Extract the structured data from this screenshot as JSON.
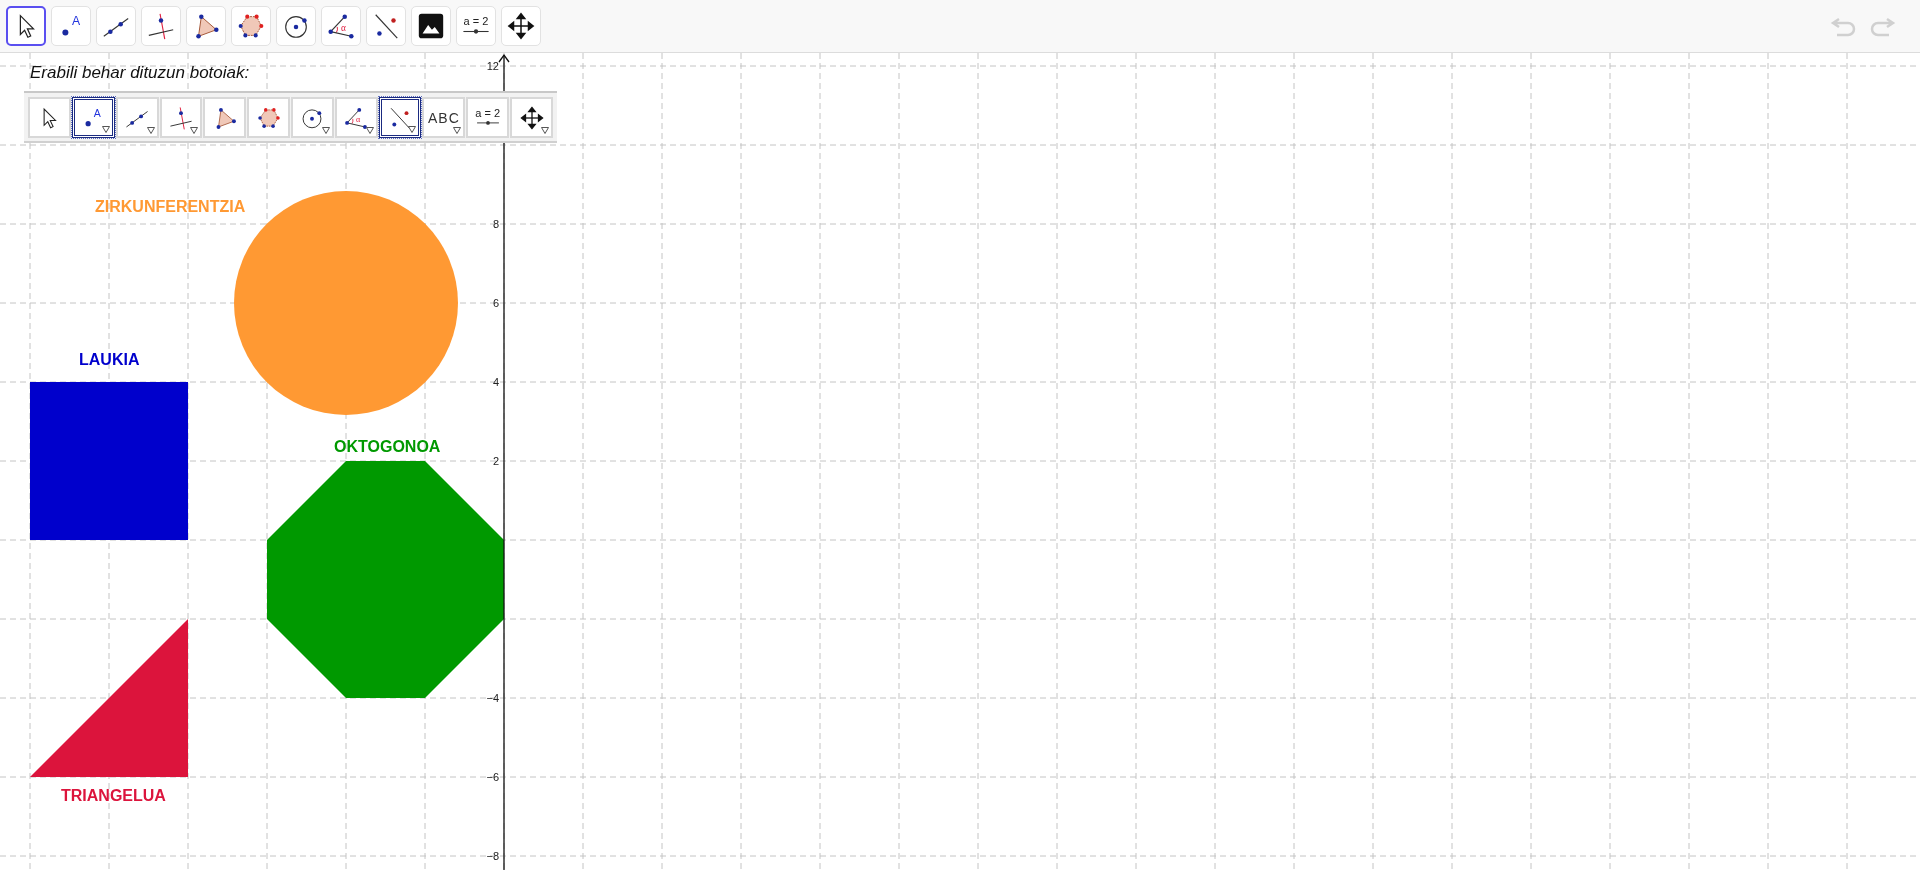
{
  "toolbar": {
    "tools": [
      {
        "kind": "move",
        "selected": true
      },
      {
        "kind": "point",
        "label": "A",
        "selected": false
      },
      {
        "kind": "line",
        "selected": false
      },
      {
        "kind": "perpendicular",
        "selected": false
      },
      {
        "kind": "polygon",
        "selected": false
      },
      {
        "kind": "regular_polygon",
        "selected": false
      },
      {
        "kind": "circle",
        "selected": false
      },
      {
        "kind": "angle",
        "label": "α",
        "selected": false
      },
      {
        "kind": "reflect",
        "selected": false
      },
      {
        "kind": "image",
        "selected": false
      },
      {
        "kind": "slider",
        "label": "a = 2",
        "selected": false
      },
      {
        "kind": "move_view",
        "selected": false
      }
    ],
    "undo": {
      "disabled": true
    },
    "redo": {
      "disabled": true
    }
  },
  "panel": {
    "caption": "Erabili behar dituzun botoiak:",
    "tools": [
      {
        "kind": "move",
        "selected": false,
        "has_menu": false
      },
      {
        "kind": "point",
        "label": "A",
        "selected": true,
        "has_menu": true
      },
      {
        "kind": "line",
        "selected": false,
        "has_menu": true
      },
      {
        "kind": "perpendicular",
        "selected": false,
        "has_menu": true
      },
      {
        "kind": "polygon",
        "selected": false,
        "has_menu": false
      },
      {
        "kind": "regular_polygon",
        "selected": false,
        "has_menu": false
      },
      {
        "kind": "circle",
        "selected": false,
        "has_menu": true
      },
      {
        "kind": "angle",
        "label": "α",
        "selected": false,
        "has_menu": true
      },
      {
        "kind": "reflect",
        "selected": true,
        "has_menu": true
      },
      {
        "kind": "text",
        "label": "ABC",
        "selected": false,
        "has_menu": true
      },
      {
        "kind": "slider",
        "label": "a = 2",
        "selected": false,
        "has_menu": false
      },
      {
        "kind": "move_view",
        "selected": false,
        "has_menu": true
      }
    ]
  },
  "y_axis": {
    "labels": [
      "12",
      "8",
      "6",
      "4",
      "2",
      "−4",
      "−6",
      "−8"
    ]
  },
  "shapes": [
    {
      "kind": "circle",
      "label": "ZIRKUNFERENTZIA",
      "color": "#ff9933"
    },
    {
      "kind": "square",
      "label": "LAUKIA",
      "color": "#0000cc"
    },
    {
      "kind": "octagon",
      "label": "OKTOGONOA",
      "color": "#009900"
    },
    {
      "kind": "triangle",
      "label": "TRIANGELUA",
      "color": "#dc143c"
    }
  ]
}
